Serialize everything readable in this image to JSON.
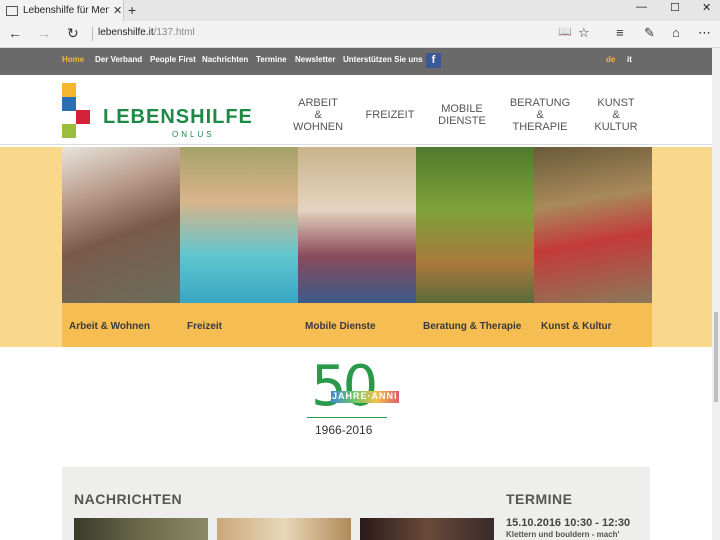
{
  "browser": {
    "tab_title": "Lebenshilfe für Mensche",
    "close_glyph": "✕",
    "newtab_glyph": "+",
    "url_host": "lebenshilfe.it",
    "url_path": "/137.html",
    "back_glyph": "←",
    "forward_glyph": "→",
    "refresh_glyph": "↻",
    "minimize_glyph": "—",
    "maximize_glyph": "☐",
    "winclose_glyph": "✕",
    "reading_glyph": "📖",
    "favorite_glyph": "☆",
    "hub_glyph": "≡",
    "note_glyph": "✎",
    "share_glyph": "⌂",
    "more_glyph": "⋯"
  },
  "topnav": {
    "items": [
      "Home",
      "Der Verband",
      "People First",
      "Nachrichten",
      "Termine",
      "Newsletter",
      "Unterstützen Sie uns"
    ],
    "fb": "f",
    "lang_de": "de",
    "lang_it": "it"
  },
  "header": {
    "logo_title": "LEBENSHILFE",
    "logo_sub": "ONLUS",
    "mainnav": [
      [
        "ARBEIT",
        "&",
        "WOHNEN"
      ],
      [
        "FREIZEIT"
      ],
      [
        "MOBILE",
        "DIENSTE"
      ],
      [
        "BERATUNG",
        "&",
        "THERAPIE"
      ],
      [
        "KUNST",
        "&",
        "KULTUR"
      ]
    ]
  },
  "banner": {
    "panels": [
      "Arbeit & Wohnen",
      "Freizeit",
      "Mobile Dienste",
      "Beratung & Therapie",
      "Kunst & Kultur"
    ]
  },
  "anniversary": {
    "number": "50",
    "jahre": "JAHRE·ANNI",
    "years": "1966-2016"
  },
  "news": {
    "heading": "NACHRICHTEN",
    "termine_heading": "TERMINE",
    "event_date": "15.10.2016 10:30 - 12:30",
    "event_text": "Klettern und bouldern - mach'"
  },
  "colors": {
    "brand_green": "#1c8a46",
    "accent_orange": "#f4b43c",
    "banner_yellow": "#f9d88c",
    "label_yellow": "#f5bd52"
  }
}
